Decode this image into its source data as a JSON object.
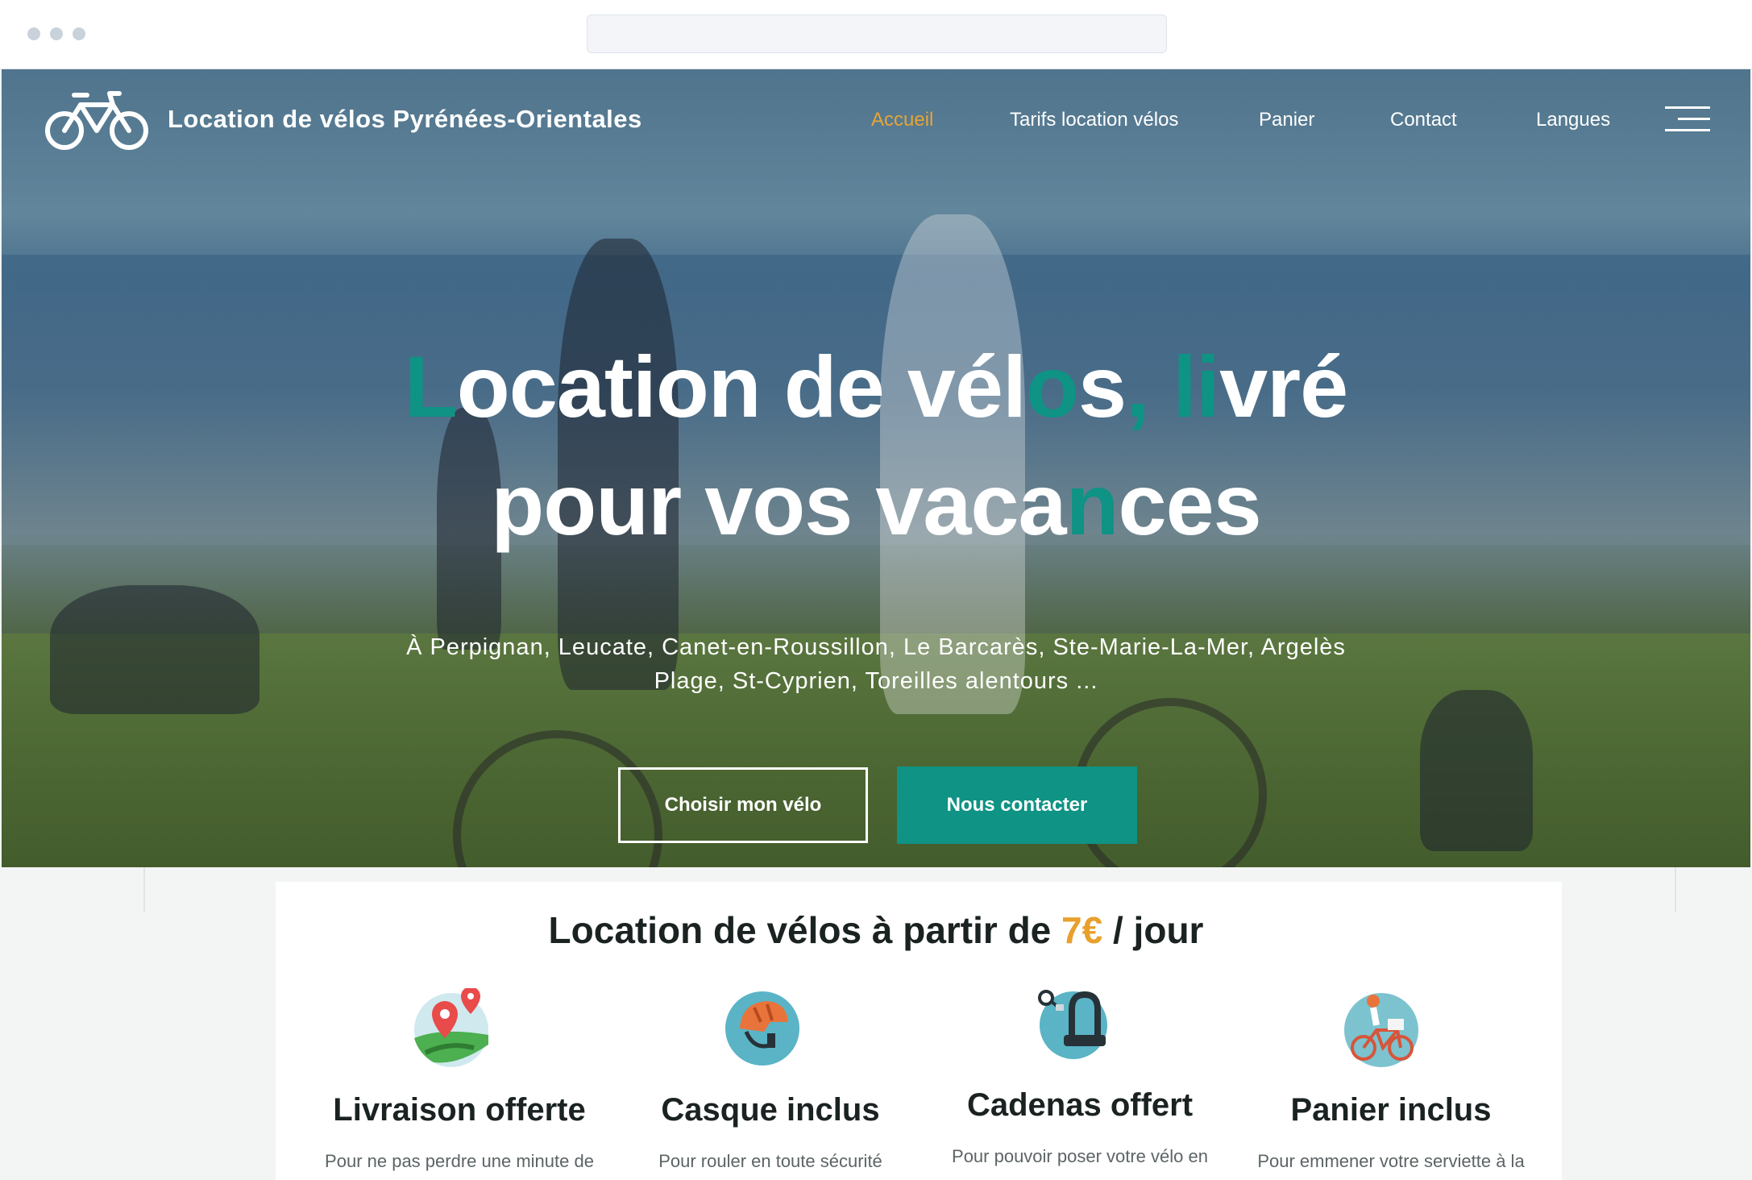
{
  "brand": {
    "name": "Location de vélos Pyrénées-Orientales",
    "logo_icon": "bicycle-icon",
    "accent_color": "#0e9384",
    "highlight_color": "#e8a435"
  },
  "nav": {
    "items": [
      {
        "label": "Accueil",
        "active": true
      },
      {
        "label": "Tarifs location vélos",
        "active": false
      },
      {
        "label": "Panier",
        "active": false
      },
      {
        "label": "Contact",
        "active": false
      },
      {
        "label": "Langues",
        "active": false
      }
    ],
    "menu_icon": "hamburger-menu-icon"
  },
  "hero": {
    "title_line1": {
      "a": "L",
      "b": "ocation de vél",
      "c": "o",
      "d": "s",
      "e": ",",
      "f": " ",
      "g": "li",
      "h": "vré"
    },
    "title_line2": {
      "a": "pour vos vaca",
      "b": "n",
      "c": "ces"
    },
    "subtitle": "À Perpignan, Leucate, Canet-en-Roussillon, Le Barcarès, Ste-Marie-La-Mer, Argelès Plage, St-Cyprien, Toreilles alentours ...",
    "button_primary": "Choisir mon vélo",
    "button_secondary": "Nous contacter"
  },
  "features": {
    "heading_prefix": "Location de vélos à partir de ",
    "heading_price": "7€",
    "heading_suffix": " / jour",
    "items": [
      {
        "icon": "map-pin-icon",
        "title": "Livraison offerte",
        "text": "Pour ne pas perdre une minute de"
      },
      {
        "icon": "helmet-icon",
        "title": "Casque inclus",
        "text": "Pour rouler en toute sécurité"
      },
      {
        "icon": "lock-icon",
        "title": "Cadenas offert",
        "text": "Pour pouvoir poser votre vélo en"
      },
      {
        "icon": "basket-bike-icon",
        "title": "Panier inclus",
        "text": "Pour emmener votre serviette à la"
      }
    ]
  }
}
